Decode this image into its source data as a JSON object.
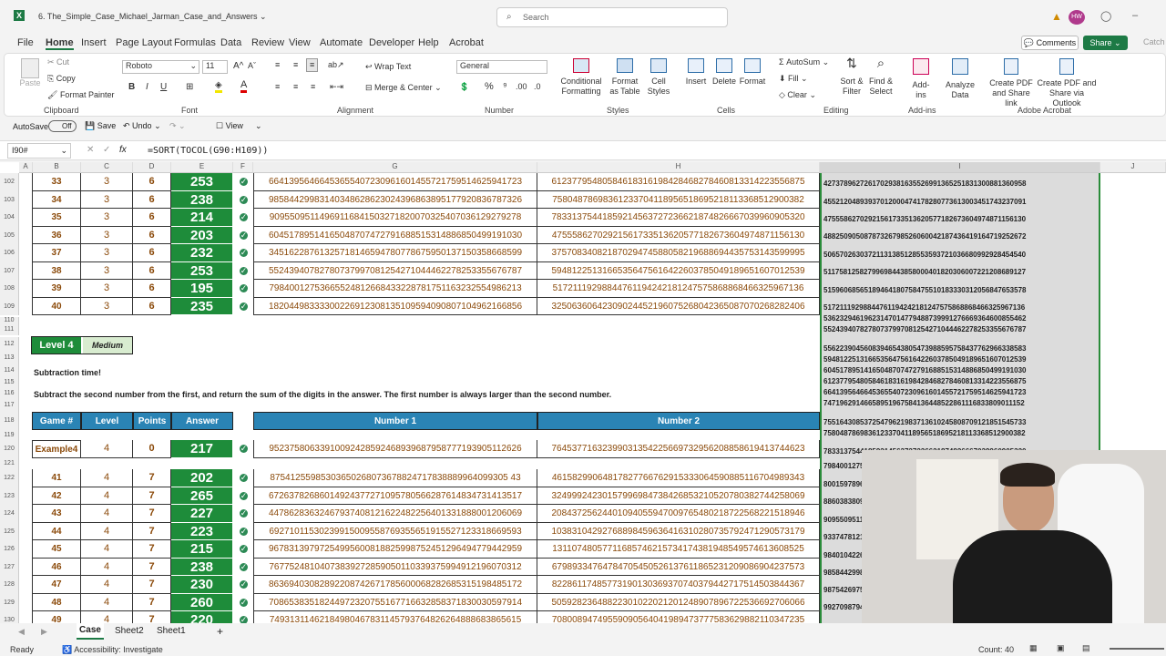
{
  "app": {
    "title": "6. The_Simple_Case_Michael_Jarman_Case_and_Answers",
    "search_placeholder": "Search",
    "avatar": "HW"
  },
  "menu": [
    "File",
    "Home",
    "Insert",
    "Page Layout",
    "Formulas",
    "Data",
    "Review",
    "View",
    "Automate",
    "Developer",
    "Help",
    "Acrobat"
  ],
  "menu_right": {
    "comments": "Comments",
    "share": "Share",
    "catch_up": "Catch"
  },
  "ribbon": {
    "clipboard": {
      "paste": "Paste",
      "cut": "Cut",
      "copy": "Copy",
      "format_painter": "Format Painter",
      "label": "Clipboard"
    },
    "font": {
      "name": "Roboto",
      "size": "11",
      "label": "Font"
    },
    "alignment": {
      "wrap": "Wrap Text",
      "merge": "Merge & Center",
      "label": "Alignment"
    },
    "number": {
      "format": "General",
      "label": "Number"
    },
    "styles": {
      "cond": "Conditional Formatting",
      "table": "Format as Table",
      "cell": "Cell Styles",
      "label": "Styles"
    },
    "cells": {
      "insert": "Insert",
      "delete": "Delete",
      "format": "Format",
      "label": "Cells"
    },
    "editing": {
      "autosum": "AutoSum",
      "fill": "Fill",
      "clear": "Clear",
      "sort": "Sort & Filter",
      "find": "Find & Select",
      "label": "Editing"
    },
    "addins": {
      "addins": "Add-ins",
      "analyze": "Analyze Data",
      "label": "Add-ins"
    },
    "acrobat": {
      "pdf_link": "Create PDF and Share link",
      "pdf_outlook": "Create PDF and Share via Outlook",
      "label": "Adobe Acrobat"
    }
  },
  "qat": {
    "autosave": "AutoSave",
    "off": "Off",
    "save": "Save",
    "undo": "Undo",
    "view": "View"
  },
  "formula": {
    "namebox": "I90#",
    "fx": "fx",
    "text": "=SORT(TOCOL(G90:H109))"
  },
  "columns": [
    "A",
    "B",
    "C",
    "D",
    "E",
    "F",
    "G",
    "H",
    "I",
    "J"
  ],
  "rows_top": [
    {
      "r": "102",
      "game": "33",
      "level": "3",
      "points": "6",
      "answer": "253",
      "n1": "66413956466453655407230961601455721759514625941723",
      "n2": "61237795480584618316198428468278460813314223556875"
    },
    {
      "r": "103",
      "game": "34",
      "level": "3",
      "points": "6",
      "answer": "238",
      "n1": "98584429983140348628623024396863895177920836787326",
      "n2": "75804878698361233704118956518695218113368512900382"
    },
    {
      "r": "104",
      "game": "35",
      "level": "3",
      "points": "6",
      "answer": "214",
      "n1": "90955095114969116841503271820070325407036129279278",
      "n2": "78331375441859214563727236621874826667039960905320"
    },
    {
      "r": "105",
      "game": "36",
      "level": "3",
      "points": "6",
      "answer": "203",
      "n1": "60451789514165048707472791688515314886850499191030",
      "n2": "47555862702921561733513620577182673604974871156130"
    },
    {
      "r": "106",
      "game": "37",
      "level": "3",
      "points": "6",
      "answer": "232",
      "n1": "34516228761325718146594780778675950137150358668599",
      "n2": "37570834082187029474588058219688694435753143599995"
    },
    {
      "r": "107",
      "game": "38",
      "level": "3",
      "points": "6",
      "answer": "253",
      "n1": "55243940782780737997081254271044462278253355676787",
      "n2": "59481225131665356475616422603785049189651607012539"
    },
    {
      "r": "108",
      "game": "39",
      "level": "3",
      "points": "6",
      "answer": "195",
      "n1": "79840012753665524812668433228781751163232554986213",
      "n2": "51721119298844761194242181247575868868466325967136"
    },
    {
      "r": "109",
      "game": "40",
      "level": "3",
      "points": "6",
      "answer": "235",
      "n1": "18204498333300226912308135109594090807104962166856",
      "n2": "32506360642309024452196075268042365087070268282406"
    }
  ],
  "level4": {
    "badge": "Level 4",
    "difficulty": "Medium",
    "heading": "Subtraction time!",
    "instructions": "Subtract the second number from the first, and return the sum of the digits in the answer. The first number is always larger than the second number.",
    "headers": [
      "Game #",
      "Level",
      "Points",
      "Answer",
      "Number 1",
      "Number 2"
    ],
    "example": {
      "r": "120",
      "game": "Example4",
      "level": "4",
      "points": "0",
      "answer": "217",
      "n1": "95237580633910092428592468939687958777193905112626",
      "n2": "76453771632399031354225669732956208858619413744623"
    }
  },
  "rows_bottom": [
    {
      "r": "122",
      "game": "41",
      "level": "4",
      "points": "7",
      "answer": "202",
      "n1": "87541255985303650268073678824717838889964099305 43",
      "n2": "46158299064817827766762915333064590885116704989343"
    },
    {
      "r": "123",
      "game": "42",
      "level": "4",
      "points": "7",
      "answer": "265",
      "n1": "67263782686014924377271095780566287614834731413517",
      "n2": "32499924230157996984738426853210520780382744258069"
    },
    {
      "r": "124",
      "game": "43",
      "level": "4",
      "points": "7",
      "answer": "227",
      "n1": "44786283632467937408121622482256401331888001206069",
      "n2": "20843725624401094055947009765480218722568221518946"
    },
    {
      "r": "125",
      "game": "44",
      "level": "4",
      "points": "7",
      "answer": "223",
      "n1": "69271011530239915009558769355651915527123318669593",
      "n2": "10383104292768898459636416310280735792471290573179"
    },
    {
      "r": "126",
      "game": "45",
      "level": "4",
      "points": "7",
      "answer": "215",
      "n1": "96783139797254995600818825998752451296494779442959",
      "n2": "13110748057711685746215734174381948549574613608525"
    },
    {
      "r": "127",
      "game": "46",
      "level": "4",
      "points": "7",
      "answer": "238",
      "n1": "76775248104073839272859050110339375994912196070312",
      "n2": "67989334764784705450526137611865231209086904237573"
    },
    {
      "r": "128",
      "game": "47",
      "level": "4",
      "points": "7",
      "answer": "230",
      "n1": "86369403082892208742671785600068282685315198485172",
      "n2": "82286117485773190130369370740379442717514503844367"
    },
    {
      "r": "129",
      "game": "48",
      "level": "4",
      "points": "7",
      "answer": "260",
      "n1": "70865383518244972320755167716632858371830030597914",
      "n2": "50592823648822301022021201248907896722536692706066"
    },
    {
      "r": "130",
      "game": "49",
      "level": "4",
      "points": "7",
      "answer": "220",
      "n1": "74931311462184980467831145793764826264888683865615",
      "n2": "70800894749559090564041989473777583629882110347235"
    }
  ],
  "col_i": [
    "42737896272617029381635526991365251831300881360958",
    "45521204893937012000474178280773613003451743237091",
    "47555862702921561733513620577182673604974871156130",
    "48825090508787326798526060042187436419164719252672",
    "50657026303721131385128553593721036680992928454540",
    "51175812582799698443858000401820306007221208689127",
    "51596068565189464180758475510183330312056847653578",
    "51721119298844761194242181247575868868466325967136",
    "53623294619623147014779488739991276669364600855462",
    "55243940782780737997081254271044462278253355676787",
    "55622390456083946543805473988595758437762966338583",
    "59481225131665356475616422603785049189651607012539",
    "60451789514165048707472791688515314886850499191030",
    "61237795480584618316198428468278460813314223556875",
    "66413956466453655407230961601455721759514625941723",
    "74719629146658951967584136448522861116833809011152",
    "75516430853725479621983713610245808709121851545733",
    "75804878698361233704118956518695218113368512900382",
    "78331375441859214563727236621874826667039960905320",
    "79840012753665524812668433228781751163232554986213",
    "80015978965",
    "88603838094",
    "90955095114",
    "93374781214",
    "98401042269",
    "98584429983",
    "98754269751",
    "99270987940"
  ],
  "sheet_tabs": [
    "Case",
    "Sheet2",
    "Sheet1"
  ],
  "status": {
    "ready": "Ready",
    "accessibility": "Accessibility: Investigate",
    "count": "Count: 40"
  }
}
